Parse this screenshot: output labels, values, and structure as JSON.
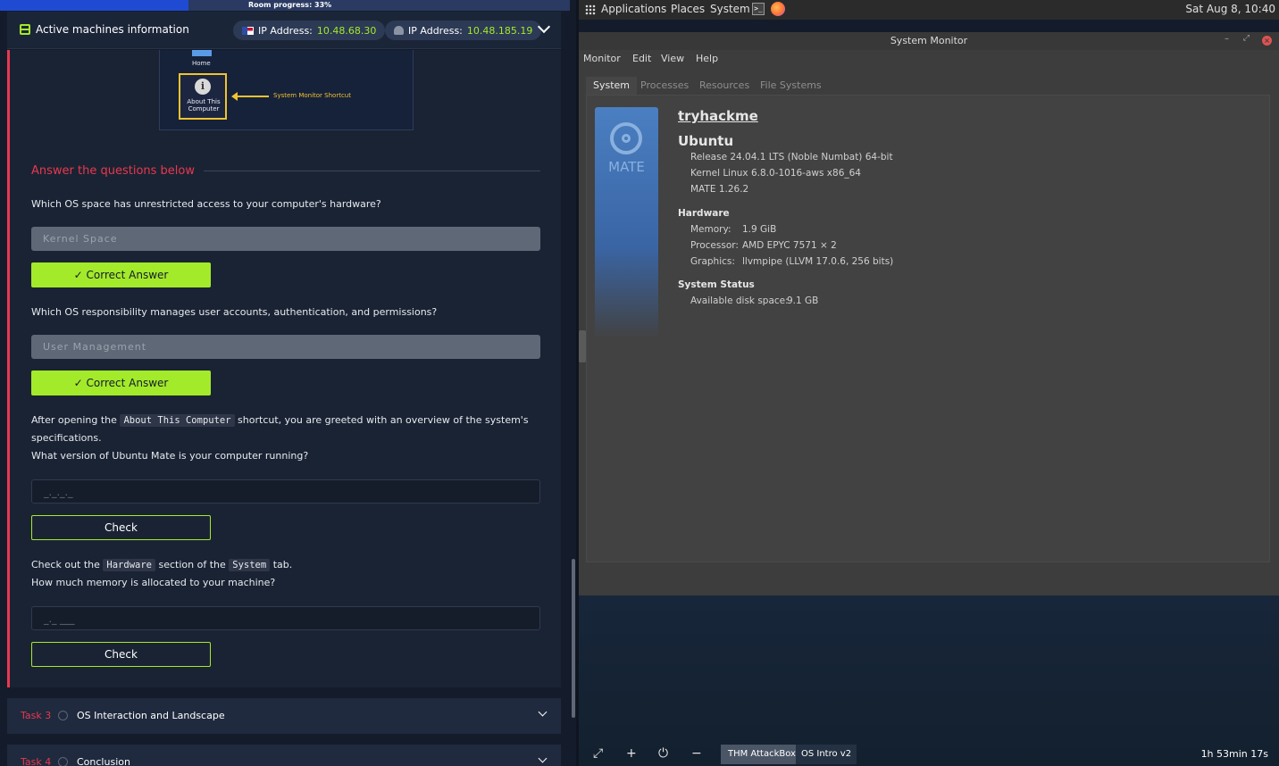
{
  "room": {
    "progress_label": "Room progress: 33%",
    "progress_fraction": 0.33
  },
  "machines": {
    "title": "Active machines information",
    "ip_label": "IP Address:",
    "ip1": "10.48.68.30",
    "ip2": "10.48.185.19"
  },
  "preview": {
    "home_label": "Home",
    "about_label": "About This Computer",
    "shortcut_label": "System Monitor Shortcut",
    "about_glyph": "i"
  },
  "questions": {
    "heading": "Answer the questions below",
    "q1": "Which OS space has unrestricted access to your computer's hardware?",
    "a1": "Kernel Space",
    "q2": "Which OS responsibility manages user accounts, authentication, and permissions?",
    "a2": "User Management",
    "correct_label": "✓ Correct Answer",
    "q3_pre": "After opening the",
    "q3_code": "About This Computer",
    "q3_post": "shortcut, you are greeted with an overview of the system's",
    "q3_line2": "specifications.",
    "q3_line3": "What version of Ubuntu Mate is your computer running?",
    "a3_placeholder": "_._._._",
    "q4_pre": "Check out the",
    "q4_code1": "Hardware",
    "q4_mid": "section of the",
    "q4_code2": "System",
    "q4_post": "tab.",
    "q4_line2": "How much memory is allocated to your machine?",
    "a4_placeholder": "_._ ___",
    "check_label": "Check"
  },
  "tasks": [
    {
      "num": "Task 3",
      "title": "OS Interaction and Landscape"
    },
    {
      "num": "Task 4",
      "title": "Conclusion"
    }
  ],
  "topbar": {
    "menus": [
      "Applications",
      "Places",
      "System"
    ],
    "terminal_glyph": ">_",
    "clock": "Sat Aug 8, 10:40"
  },
  "sysmon": {
    "title": "System Monitor",
    "menus": [
      "Monitor",
      "Edit",
      "View",
      "Help"
    ],
    "tabs": [
      "System",
      "Processes",
      "Resources",
      "File Systems"
    ],
    "active_tab": "System",
    "logo_text": "MATE",
    "hostname": "tryhackme",
    "distro": "Ubuntu",
    "release": "Release 24.04.1 LTS (Noble Numbat) 64-bit",
    "kernel": "Kernel Linux 6.8.0-1016-aws x86_64",
    "mate_version": "MATE 1.26.2",
    "hardware_heading": "Hardware",
    "memory_key": "Memory:",
    "memory_val": "1.9 GiB",
    "processor_key": "Processor:",
    "processor_val": "AMD EPYC 7571 × 2",
    "graphics_key": "Graphics:",
    "graphics_val": "llvmpipe (LLVM 17.0.6, 256 bits)",
    "status_heading": "System Status",
    "disk_key": "Available disk space:",
    "disk_val": "9.1 GB"
  },
  "dock": {
    "attackbox": "THM AttackBox",
    "osintro": "OS Intro v2",
    "timer": "1h 53min 17s"
  },
  "colors": {
    "accent_green": "#a3ea2a",
    "accent_red": "#e8384f",
    "progress_blue": "#1f4ad2"
  },
  "icons": [
    "server-icon",
    "flag-icon",
    "helmet-icon",
    "chevron-down-icon",
    "info-icon",
    "apps-grid-icon",
    "terminal-icon",
    "firefox-icon",
    "mate-logo-icon",
    "fullscreen-icon",
    "plus-icon",
    "power-icon",
    "minus-icon"
  ]
}
